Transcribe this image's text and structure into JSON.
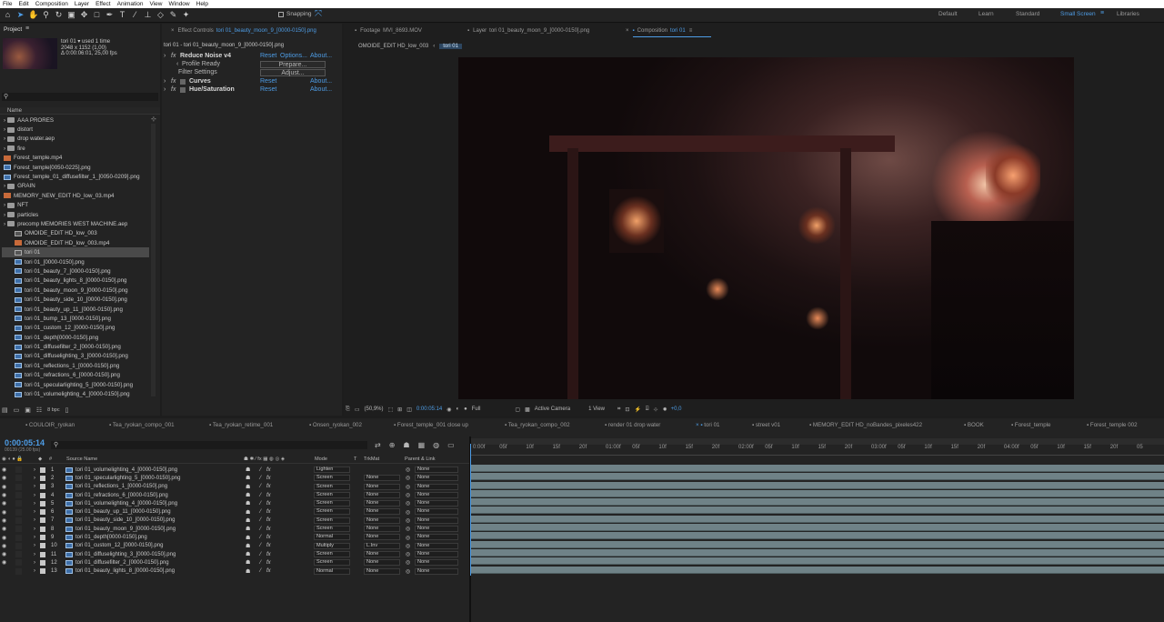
{
  "menu": [
    "File",
    "Edit",
    "Composition",
    "Layer",
    "Effect",
    "Animation",
    "View",
    "Window",
    "Help"
  ],
  "toolbar": {
    "snapping_label": "Snapping"
  },
  "workspaces": [
    "Default",
    "Learn",
    "Standard",
    "Small Screen",
    "Libraries"
  ],
  "project": {
    "tab_label": "Project",
    "thumb_name": "tori 01",
    "thumb_used": "used 1 time",
    "thumb_dims": "2048 x 1152 (1,00)",
    "thumb_duration": "Δ 0:00:06:01, 25,00 fps",
    "col_name": "Name",
    "search_placeholder": "",
    "footer_bpc": "8 bpc",
    "items": [
      {
        "label": "AAA PRORES",
        "type": "folder"
      },
      {
        "label": "distort",
        "type": "folder"
      },
      {
        "label": "drop water.aep",
        "type": "folder"
      },
      {
        "label": "fire",
        "type": "folder"
      },
      {
        "label": "Forest_temple.mp4",
        "type": "vid"
      },
      {
        "label": "Forest_temple[0050-0225].png",
        "type": "img"
      },
      {
        "label": "Forest_temple_01_diffusefilter_1_[0050-0209].png",
        "type": "img"
      },
      {
        "label": "GRAIN",
        "type": "folder"
      },
      {
        "label": "MEMORY_NEW_EDIT HD_low_03.mp4",
        "type": "vid"
      },
      {
        "label": "NFT",
        "type": "folder"
      },
      {
        "label": "particles",
        "type": "folder"
      },
      {
        "label": "precomp MEMORIES WEST MACHINE.aep",
        "type": "folder"
      },
      {
        "label": "OMOIDE_EDIT HD_low_003",
        "type": "comp"
      },
      {
        "label": "OMOIDE_EDIT HD_low_003.mp4",
        "type": "vid"
      },
      {
        "label": "tori 01",
        "type": "comp"
      },
      {
        "label": "tori 01_[0000-0150].png",
        "type": "img"
      },
      {
        "label": "tori 01_beauty_7_[0000-0150].png",
        "type": "img"
      },
      {
        "label": "tori 01_beauty_lights_8_[0000-0150].png",
        "type": "img"
      },
      {
        "label": "tori 01_beauty_moon_9_[0000-0150].png",
        "type": "img"
      },
      {
        "label": "tori 01_beauty_side_10_[0000-0150].png",
        "type": "img"
      },
      {
        "label": "tori 01_beauty_up_11_[0000-0150].png",
        "type": "img"
      },
      {
        "label": "tori 01_bump_13_[0000-0150].png",
        "type": "img"
      },
      {
        "label": "tori 01_custom_12_[0000-0150].png",
        "type": "img"
      },
      {
        "label": "tori 01_depth[0000-0150].png",
        "type": "img"
      },
      {
        "label": "tori 01_diffusefilter_2_[0000-0150].png",
        "type": "img"
      },
      {
        "label": "tori 01_diffuselighting_3_[0000-0150].png",
        "type": "img"
      },
      {
        "label": "tori 01_reflections_1_[0000-0150].png",
        "type": "img"
      },
      {
        "label": "tori 01_refractions_6_[0000-0150].png",
        "type": "img"
      },
      {
        "label": "tori 01_specularlighting_5_[0000-0150].png",
        "type": "img"
      },
      {
        "label": "tori 01_volumelighting_4_[0000-0150].png",
        "type": "img"
      }
    ]
  },
  "effects": {
    "tab_prefix": "Effect Controls",
    "tab_layer": "tori 01_beauty_moon_9_[0000-0150].png",
    "header": "tori 01 - tori 01_beauty_moon_9_[0000-0150].png",
    "rows": [
      {
        "name": "Reduce Noise v4",
        "reset": "Reset",
        "extra": "Options...",
        "about": "About..."
      },
      {
        "name": "Profile Ready",
        "button": "Prepare..."
      },
      {
        "name": "Filter Settings",
        "button": "Adjust..."
      },
      {
        "name": "Curves",
        "reset": "Reset",
        "about": "About..."
      },
      {
        "name": "Hue/Saturation",
        "reset": "Reset",
        "about": "About..."
      }
    ]
  },
  "viewer": {
    "tabs": [
      {
        "prefix": "Footage",
        "name": "MVI_8693.MOV"
      },
      {
        "prefix": "Layer",
        "name": "tori 01_beauty_moon_9_[0000-0150].png"
      },
      {
        "prefix": "Composition",
        "name": "tori 01"
      }
    ],
    "breadcrumb": [
      "OMOIDE_EDIT HD_low_003",
      "tori 01"
    ],
    "zoom": "(50,9%)",
    "timecode": "0:00:05:14",
    "resolution": "Full",
    "camera": "Active Camera",
    "views": "1 View",
    "exposure": "+0,0"
  },
  "timeline": {
    "tabs": [
      "COULOIR_ryokan",
      "Tea_ryokan_compo_001",
      "Tea_ryokan_retime_001",
      "Onsen_ryokan_002",
      "Forest_temple_001 close up",
      "Tea_ryokan_compo_002",
      "render 01 drop water",
      "tori 01",
      "street v01",
      "MEMORY_EDIT HD_noBandes_pixeles422",
      "BOOK",
      "Forest_temple",
      "Forest_temple 002"
    ],
    "active_tab": "tori 01",
    "timecode": "0:00:05:14",
    "frame_info": "00139 (25.00 fps)",
    "col_source": "Source Name",
    "col_mode": "Mode",
    "col_t": "T",
    "col_trkmat": "TrkMat",
    "col_parent": "Parent & Link",
    "ruler": [
      "0:00f",
      "05f",
      "10f",
      "15f",
      "20f",
      "01:00f",
      "05f",
      "10f",
      "15f",
      "20f",
      "02:00f",
      "05f",
      "10f",
      "15f",
      "20f",
      "03:00f",
      "05f",
      "10f",
      "15f",
      "20f",
      "04:00f",
      "05f",
      "10f",
      "15f",
      "20f",
      "05"
    ],
    "layers": [
      {
        "num": "1",
        "name": "tori 01_volumelighting_4_[0000-0150].png",
        "mode": "Lighten",
        "trk": "",
        "parent": "None"
      },
      {
        "num": "2",
        "name": "tori 01_specularlighting_5_[0000-0150].png",
        "mode": "Screen",
        "trk": "None",
        "parent": "None"
      },
      {
        "num": "3",
        "name": "tori 01_reflections_1_[0000-0150].png",
        "mode": "Screen",
        "trk": "None",
        "parent": "None"
      },
      {
        "num": "4",
        "name": "tori 01_refractions_6_[0000-0150].png",
        "mode": "Screen",
        "trk": "None",
        "parent": "None"
      },
      {
        "num": "5",
        "name": "tori 01_volumelighting_4_[0000-0150].png",
        "mode": "Screen",
        "trk": "None",
        "parent": "None"
      },
      {
        "num": "6",
        "name": "tori 01_beauty_up_11_[0000-0150].png",
        "mode": "Screen",
        "trk": "None",
        "parent": "None"
      },
      {
        "num": "7",
        "name": "tori 01_beauty_side_10_[0000-0150].png",
        "mode": "Screen",
        "trk": "None",
        "parent": "None"
      },
      {
        "num": "8",
        "name": "tori 01_beauty_moon_9_[0000-0150].png",
        "mode": "Screen",
        "trk": "None",
        "parent": "None"
      },
      {
        "num": "9",
        "name": "tori 01_depth[0000-0150].png",
        "mode": "Normal",
        "trk": "None",
        "parent": "None"
      },
      {
        "num": "10",
        "name": "tori 01_custom_12_[0000-0150].png",
        "mode": "Multiply",
        "trk": "L.Inv",
        "parent": "None"
      },
      {
        "num": "11",
        "name": "tori 01_diffuselighting_3_[0000-0150].png",
        "mode": "Screen",
        "trk": "None",
        "parent": "None"
      },
      {
        "num": "12",
        "name": "tori 01_diffusefilter_2_[0000-0150].png",
        "mode": "Screen",
        "trk": "None",
        "parent": "None"
      },
      {
        "num": "13",
        "name": "tori 01_beauty_lights_8_[0000-0150].png",
        "mode": "Normal",
        "trk": "None",
        "parent": "None"
      }
    ]
  },
  "colors": {
    "accent": "#4e9de6",
    "panel": "#232323",
    "bar": "#6f8287"
  }
}
